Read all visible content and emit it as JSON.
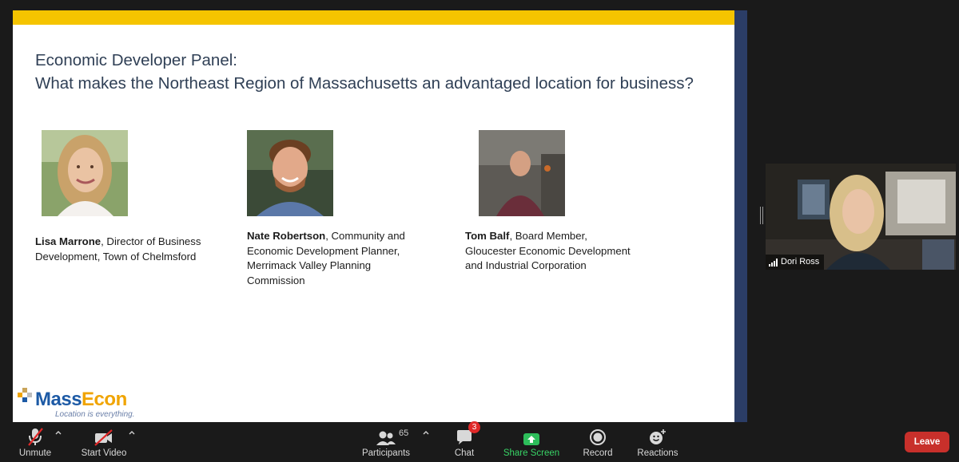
{
  "slide": {
    "title_line1": "Economic Developer Panel:",
    "title_line2": "What makes the Northeast Region of Massachusetts an advantaged location for business?",
    "panelists": [
      {
        "name": "Lisa Marrone",
        "role_lines": [
          ", Director of Business",
          "Development, Town of Chelmsford"
        ]
      },
      {
        "name": "Nate Robertson",
        "role_lines": [
          ", Community and",
          "Economic Development Planner,",
          "Merrimack Valley Planning",
          "Commission"
        ]
      },
      {
        "name": "Tom Balf",
        "role_lines": [
          ", Board Member,",
          "Gloucester Economic Development",
          "and Industrial Corporation"
        ]
      }
    ],
    "logo": {
      "brand_mass": "Mass",
      "brand_econ": "Econ",
      "tagline": "Location is everything."
    },
    "colors": {
      "accent_bar": "#f5c400",
      "side_bar": "#2b3d66",
      "title": "#2f3f55"
    }
  },
  "video": {
    "participant_name": "Dori Ross"
  },
  "toolbar": {
    "unmute_label": "Unmute",
    "start_video_label": "Start Video",
    "participants_label": "Participants",
    "participants_count": "65",
    "chat_label": "Chat",
    "chat_badge": "3",
    "share_label": "Share Screen",
    "record_label": "Record",
    "reactions_label": "Reactions",
    "leave_label": "Leave",
    "colors": {
      "share": "#38d466",
      "leave": "#c8302b",
      "badge": "#e02828"
    }
  }
}
